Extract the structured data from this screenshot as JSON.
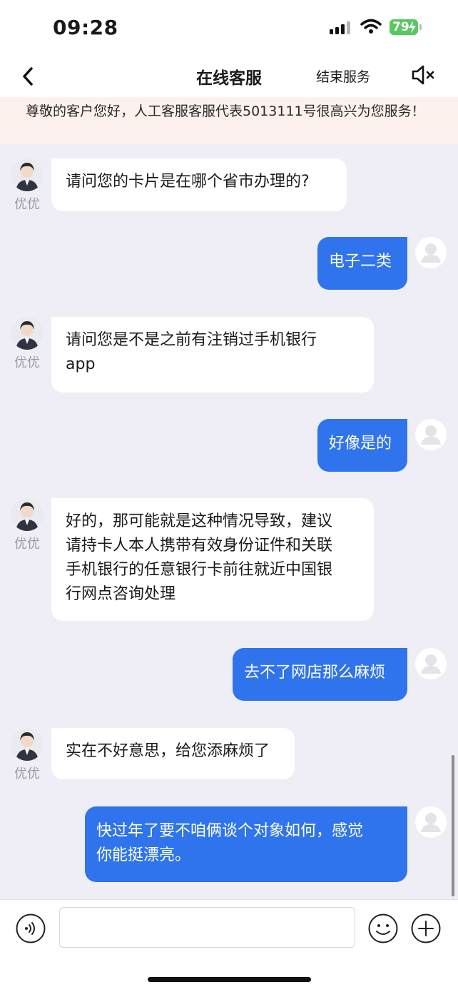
{
  "status_bar": {
    "time": "09:28",
    "battery": "79"
  },
  "nav": {
    "title": "在线客服",
    "end_service": "结束服务"
  },
  "notice": {
    "text": "尊敬的客户您好，人工客服客服代表5013111号很高兴为您服务！"
  },
  "agent_name": "优优",
  "messages": [
    {
      "from": "agent",
      "text": "请问您的卡片是在哪个省市办理的?"
    },
    {
      "from": "user",
      "text": "电子二类"
    },
    {
      "from": "agent",
      "text": "请问您是不是之前有注销过手机银行\napp"
    },
    {
      "from": "user",
      "text": "好像是的"
    },
    {
      "from": "agent",
      "text": "好的，那可能就是这种情况导致，建议\n请持卡人本人携带有效身份证件和关联\n手机银行的任意银行卡前往就近中国银\n行网点咨询处理"
    },
    {
      "from": "user",
      "text": "去不了网店那么麻烦"
    },
    {
      "from": "agent",
      "text": "实在不好意思，给您添麻烦了"
    },
    {
      "from": "user",
      "text": "快过年了要不咱俩谈个对象如何，感觉\n你能挺漂亮。"
    }
  ],
  "input": {
    "value": "",
    "placeholder": ""
  },
  "icons": {
    "back": "chevron-left-icon",
    "mute": "speaker-mute-icon",
    "voice": "voice-icon",
    "emoji": "smiley-icon",
    "plus": "plus-icon"
  },
  "colors": {
    "user_bubble": "#2f74ec",
    "agent_bubble": "#ffffff",
    "notice_bg": "#fdf1ee",
    "chat_bg": "#efeef6"
  }
}
